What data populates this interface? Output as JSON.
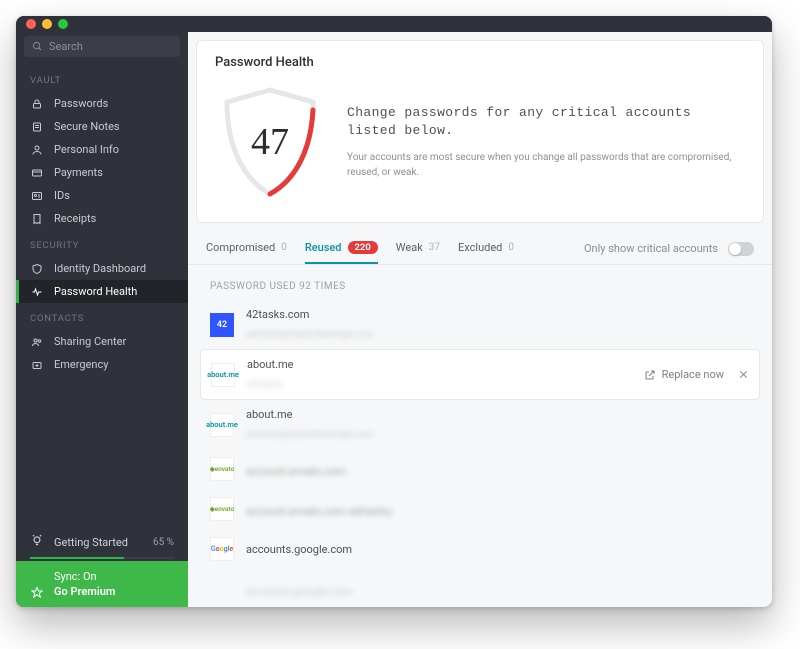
{
  "search": {
    "placeholder": "Search"
  },
  "sidebar": {
    "sections": [
      {
        "title": "VAULT",
        "items": [
          {
            "id": "passwords",
            "label": "Passwords"
          },
          {
            "id": "secure-notes",
            "label": "Secure Notes"
          },
          {
            "id": "personal-info",
            "label": "Personal Info"
          },
          {
            "id": "payments",
            "label": "Payments"
          },
          {
            "id": "ids",
            "label": "IDs"
          },
          {
            "id": "receipts",
            "label": "Receipts"
          }
        ]
      },
      {
        "title": "SECURITY",
        "items": [
          {
            "id": "identity-dashboard",
            "label": "Identity Dashboard"
          },
          {
            "id": "password-health",
            "label": "Password Health",
            "active": true
          }
        ]
      },
      {
        "title": "CONTACTS",
        "items": [
          {
            "id": "sharing-center",
            "label": "Sharing Center"
          },
          {
            "id": "emergency",
            "label": "Emergency"
          }
        ]
      }
    ]
  },
  "getting_started": {
    "label": "Getting Started",
    "percent_label": "65 %",
    "percent": 65
  },
  "footer": {
    "sync_label": "Sync: On",
    "premium_label": "Go Premium"
  },
  "card": {
    "title": "Password Health",
    "score": "47",
    "heading": "Change passwords for any critical accounts listed below.",
    "subtext": "Your accounts are most secure when you change all passwords that are compromised, reused, or weak."
  },
  "tabs": {
    "compromised": {
      "label": "Compromised",
      "count": "0"
    },
    "reused": {
      "label": "Reused",
      "count": "220"
    },
    "weak": {
      "label": "Weak",
      "count": "37"
    },
    "excluded": {
      "label": "Excluded",
      "count": "0"
    }
  },
  "tabs_right": {
    "critical_label": "Only show critical accounts",
    "toggle_on": false
  },
  "list": {
    "group_header": "PASSWORD USED 92 TIMES",
    "replace_label": "Replace now",
    "rows": [
      {
        "site": "42tasks.com",
        "sub": "adriantry@tryanothersingle.com",
        "icon": "42"
      },
      {
        "site": "about.me",
        "sub": "adriantry",
        "icon": "about",
        "hovered": true
      },
      {
        "site": "about.me",
        "sub": "adriantry@tryanothersingle.com",
        "icon": "about"
      },
      {
        "site": "",
        "sub": "account.envato.com",
        "icon": "envato",
        "title_blur": true
      },
      {
        "site": "",
        "sub": "account.envato.com adriantry",
        "icon": "envato",
        "title_blur": true
      },
      {
        "site": "accounts.google.com",
        "sub": "",
        "icon": "google"
      },
      {
        "site": "accounts.google.com",
        "sub": "",
        "icon": "google",
        "title_blur": true
      }
    ]
  }
}
